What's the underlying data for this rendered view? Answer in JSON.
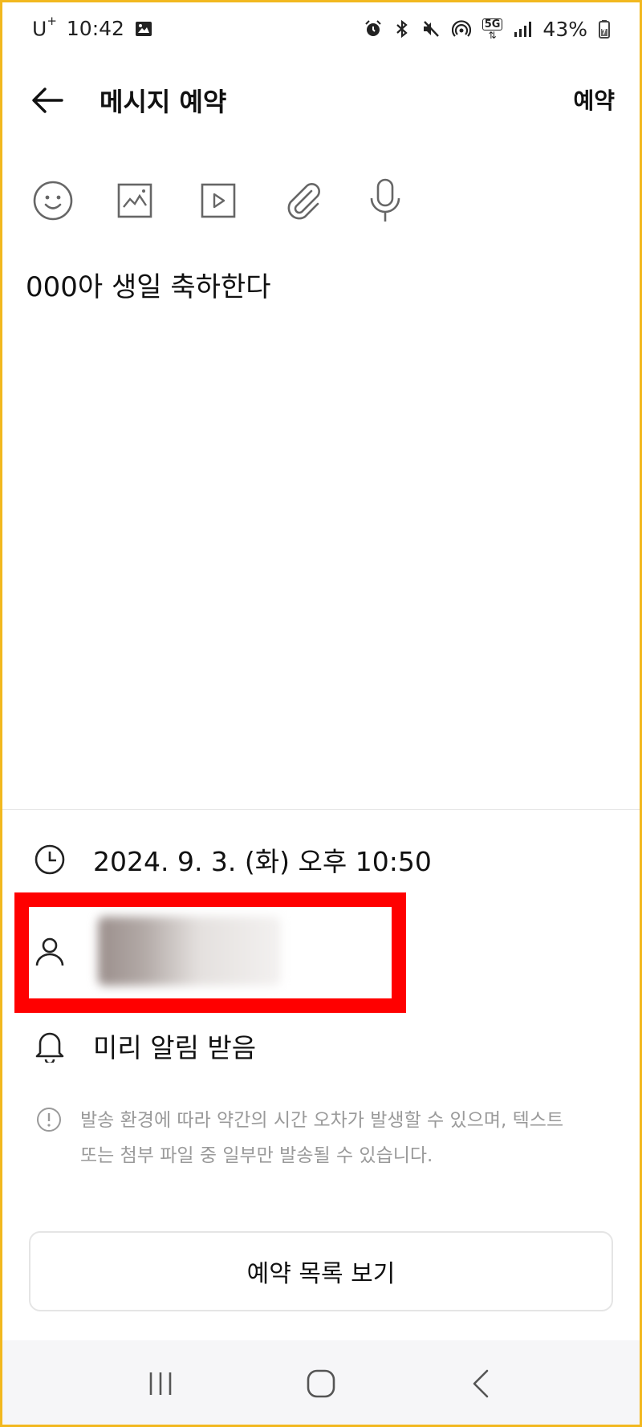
{
  "status_bar": {
    "carrier": "U",
    "carrier_sup": "+",
    "time": "10:42",
    "network": "5G",
    "battery": "43%",
    "icons": [
      "gallery-icon",
      "alarm-icon",
      "bluetooth-icon",
      "mute-icon",
      "hotspot-icon",
      "5g-icon",
      "signal-icon",
      "battery-icon"
    ]
  },
  "header": {
    "title": "메시지 예약",
    "action_label": "예약"
  },
  "toolbar": {
    "icons": [
      "emoji-icon",
      "image-icon",
      "video-icon",
      "attachment-icon",
      "microphone-icon"
    ]
  },
  "message": {
    "text": "000아 생일 축하한다"
  },
  "schedule": {
    "datetime": "2024. 9. 3. (화) 오후 10:50",
    "notify_label": "미리 알림 받음"
  },
  "notice": {
    "text_line1": "발송 환경에 따라 약간의 시간 오차가 발생할 수 있으며, 텍스트",
    "text_line2": "또는 첨부 파일 중 일부만 발송될 수 있습니다."
  },
  "buttons": {
    "view_list_label": "예약 목록 보기"
  },
  "colors": {
    "highlight_border": "#ff0000",
    "frame": "#f2b81f",
    "notice_text": "#9a9a9a",
    "nav_bg": "#f6f6f8"
  }
}
